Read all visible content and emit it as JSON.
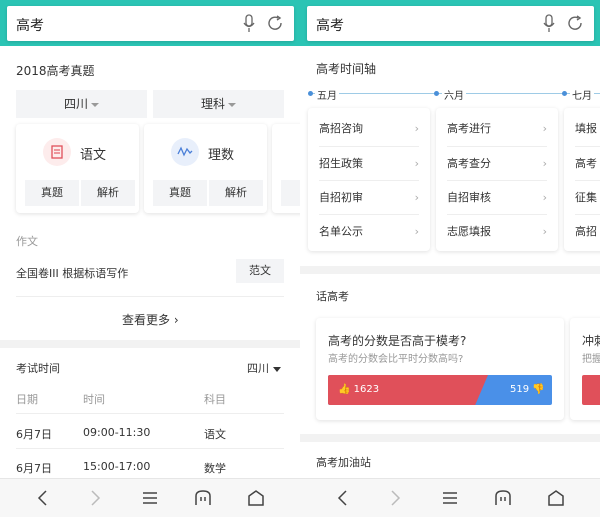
{
  "left": {
    "search_text": "高考",
    "zhenti": {
      "title": "2018高考真题",
      "province": "四川",
      "track": "理科",
      "subjects": [
        {
          "name": "语文",
          "buttons": [
            "真题",
            "解析"
          ],
          "color": "#e0505a"
        },
        {
          "name": "理数",
          "buttons": [
            "真题",
            "解析"
          ],
          "color": "#4a7fd8"
        },
        {
          "name": "",
          "buttons": [
            "真"
          ],
          "color": "#999999"
        }
      ]
    },
    "essay": {
      "title": "作文",
      "row_text": "全国卷III  根据标语写作",
      "row_button": "范文",
      "more": "查看更多"
    },
    "exam_time": {
      "title": "考试时间",
      "province": "四川",
      "headers": [
        "日期",
        "时间",
        "科目"
      ],
      "rows": [
        [
          "6月7日",
          "09:00-11:30",
          "语文"
        ],
        [
          "6月7日",
          "15:00-17:00",
          "数学"
        ]
      ]
    }
  },
  "right": {
    "search_text": "高考",
    "timeline": {
      "title": "高考时间轴",
      "columns": [
        {
          "month": "五月",
          "items": [
            "高招咨询",
            "招生政策",
            "自招初审",
            "名单公示"
          ]
        },
        {
          "month": "六月",
          "items": [
            "高考进行",
            "高考查分",
            "自招审核",
            "志愿填报"
          ]
        },
        {
          "month": "七月",
          "items": [
            "填报",
            "高考",
            "征集",
            "高招"
          ]
        }
      ]
    },
    "topic": {
      "title": "话高考",
      "question": "高考的分数是否高于模考?",
      "subtitle": "高考的分数会比平时分数高吗?",
      "yes_count": "1623",
      "no_count": "519",
      "yes_color": "#e0505a",
      "no_color": "#4a90e8",
      "next_title": "冲刺",
      "next_sub": "把握"
    },
    "cheer": {
      "title": "高考加油站"
    }
  }
}
